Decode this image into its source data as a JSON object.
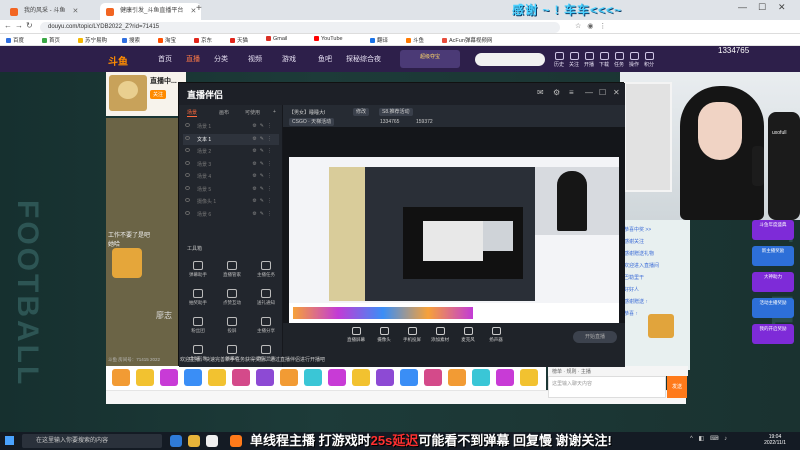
{
  "browser": {
    "tabs": [
      {
        "label": "我的风采 - 斗鱼",
        "active": false
      },
      {
        "label": "健康引发_斗鱼直播平台",
        "active": true
      }
    ],
    "new_tab": "+",
    "url": "douyu.com/topic/LYDB2022_Z?rid=71415",
    "bookmarks": [
      {
        "label": "百度",
        "color": "#2f6fe0"
      },
      {
        "label": "首页",
        "color": "#3aa845"
      },
      {
        "label": "苏宁易购",
        "color": "#f5b800"
      },
      {
        "label": "搜索",
        "color": "#2f6fe0"
      },
      {
        "label": "淘宝",
        "color": "#ff5000"
      },
      {
        "label": "京东",
        "color": "#e1251b"
      },
      {
        "label": "天猫",
        "color": "#e1251b"
      },
      {
        "label": "Gmail",
        "color": "#d93025"
      },
      {
        "label": "YouTube",
        "color": "#ff0000"
      },
      {
        "label": "翻译",
        "color": "#1a73e8"
      },
      {
        "label": "斗鱼",
        "color": "#ff7a00"
      },
      {
        "label": "AcFun弹幕视频网",
        "color": "#e74c3c"
      }
    ]
  },
  "site": {
    "logo": "斗鱼",
    "nav": [
      "首页",
      "直播",
      "分类",
      "视频",
      "游戏",
      "鱼吧",
      "探秘综合夜"
    ],
    "active_nav": "直播",
    "promo_pill": "超级夺宝",
    "right_nav": [
      "历史",
      "关注",
      "开播",
      "下载",
      "任务",
      "操作",
      "积分"
    ],
    "fans_count": "1334765"
  },
  "streamer": {
    "title": "直播中...",
    "badge": "关注"
  },
  "page": {
    "video_caption_1": "工作不要了是吧",
    "video_caption_2": "她哈",
    "zhiyuan": "廖志",
    "room_info": "斗鱼 房间号：71415  2022",
    "side_text": "FOOTBALL"
  },
  "webcam": {
    "banner": "感谢 ~ ! 车车<<<~",
    "chair_brand": "uxofull"
  },
  "obs": {
    "logo": "直播伴侣",
    "left_tabs": [
      "场景",
      "画布",
      "可使用"
    ],
    "scenes": [
      {
        "name": "场景 1",
        "active": false
      },
      {
        "name": "文本 1",
        "active": true
      },
      {
        "name": "场景 2",
        "active": false
      },
      {
        "name": "场景 3",
        "active": false
      },
      {
        "name": "场景 4",
        "active": false
      },
      {
        "name": "场景 5",
        "active": false
      },
      {
        "name": "摄像头 1",
        "active": false
      },
      {
        "name": "场景 6",
        "active": false
      }
    ],
    "tools_title": "工具箱",
    "tools": [
      "弹幕助手",
      "直播管家",
      "主播任务",
      "抽奖助手",
      "点赞互动",
      "送礼通知",
      "粉丝团",
      "投屏",
      "主播分享",
      "虚拟形象",
      "弹幕墙",
      "歌词显示"
    ],
    "room_title": "【男女】睡睡大Ⅰ",
    "chips": [
      "修改",
      "S8.推荐活动"
    ],
    "category": "CSGO · 天梯活动",
    "stats": [
      "1334765",
      "159372"
    ],
    "bottom_buttons": [
      "直播屏幕",
      "摄像头",
      "手机投屏",
      "添加素材",
      "麦克风",
      "扬声器"
    ],
    "start_live": "开始直播",
    "notice": "欢迎主播，快速完善新手任务获得奖励、通过直播伴侣进行开播吧"
  },
  "chat": {
    "lines": [
      "恭喜中奖 >>",
      "感谢关注",
      "感谢赠送礼物",
      "欢迎进入直播间",
      "巴勒里干",
      "好好人",
      "感谢赠送 ↑",
      "恭喜 ↑"
    ],
    "input_placeholder": "这里输入聊天内容",
    "send": "发送",
    "tabs": "榜单 · 规则 · 主播"
  },
  "promos": [
    "斗鱼年度盛典",
    "新主播奖励",
    "大神助力",
    "活动主播奖励",
    "我的开启奖励"
  ],
  "taskbar": {
    "search_placeholder": "在这里输入你要搜索的内容",
    "marquee_a": "单线程主播 打游戏时",
    "marquee_hl": "25s延迟",
    "marquee_b": "可能看不到弹幕 回复慢 谢谢关注!",
    "time": "19:04",
    "date": "2022/11/1"
  }
}
